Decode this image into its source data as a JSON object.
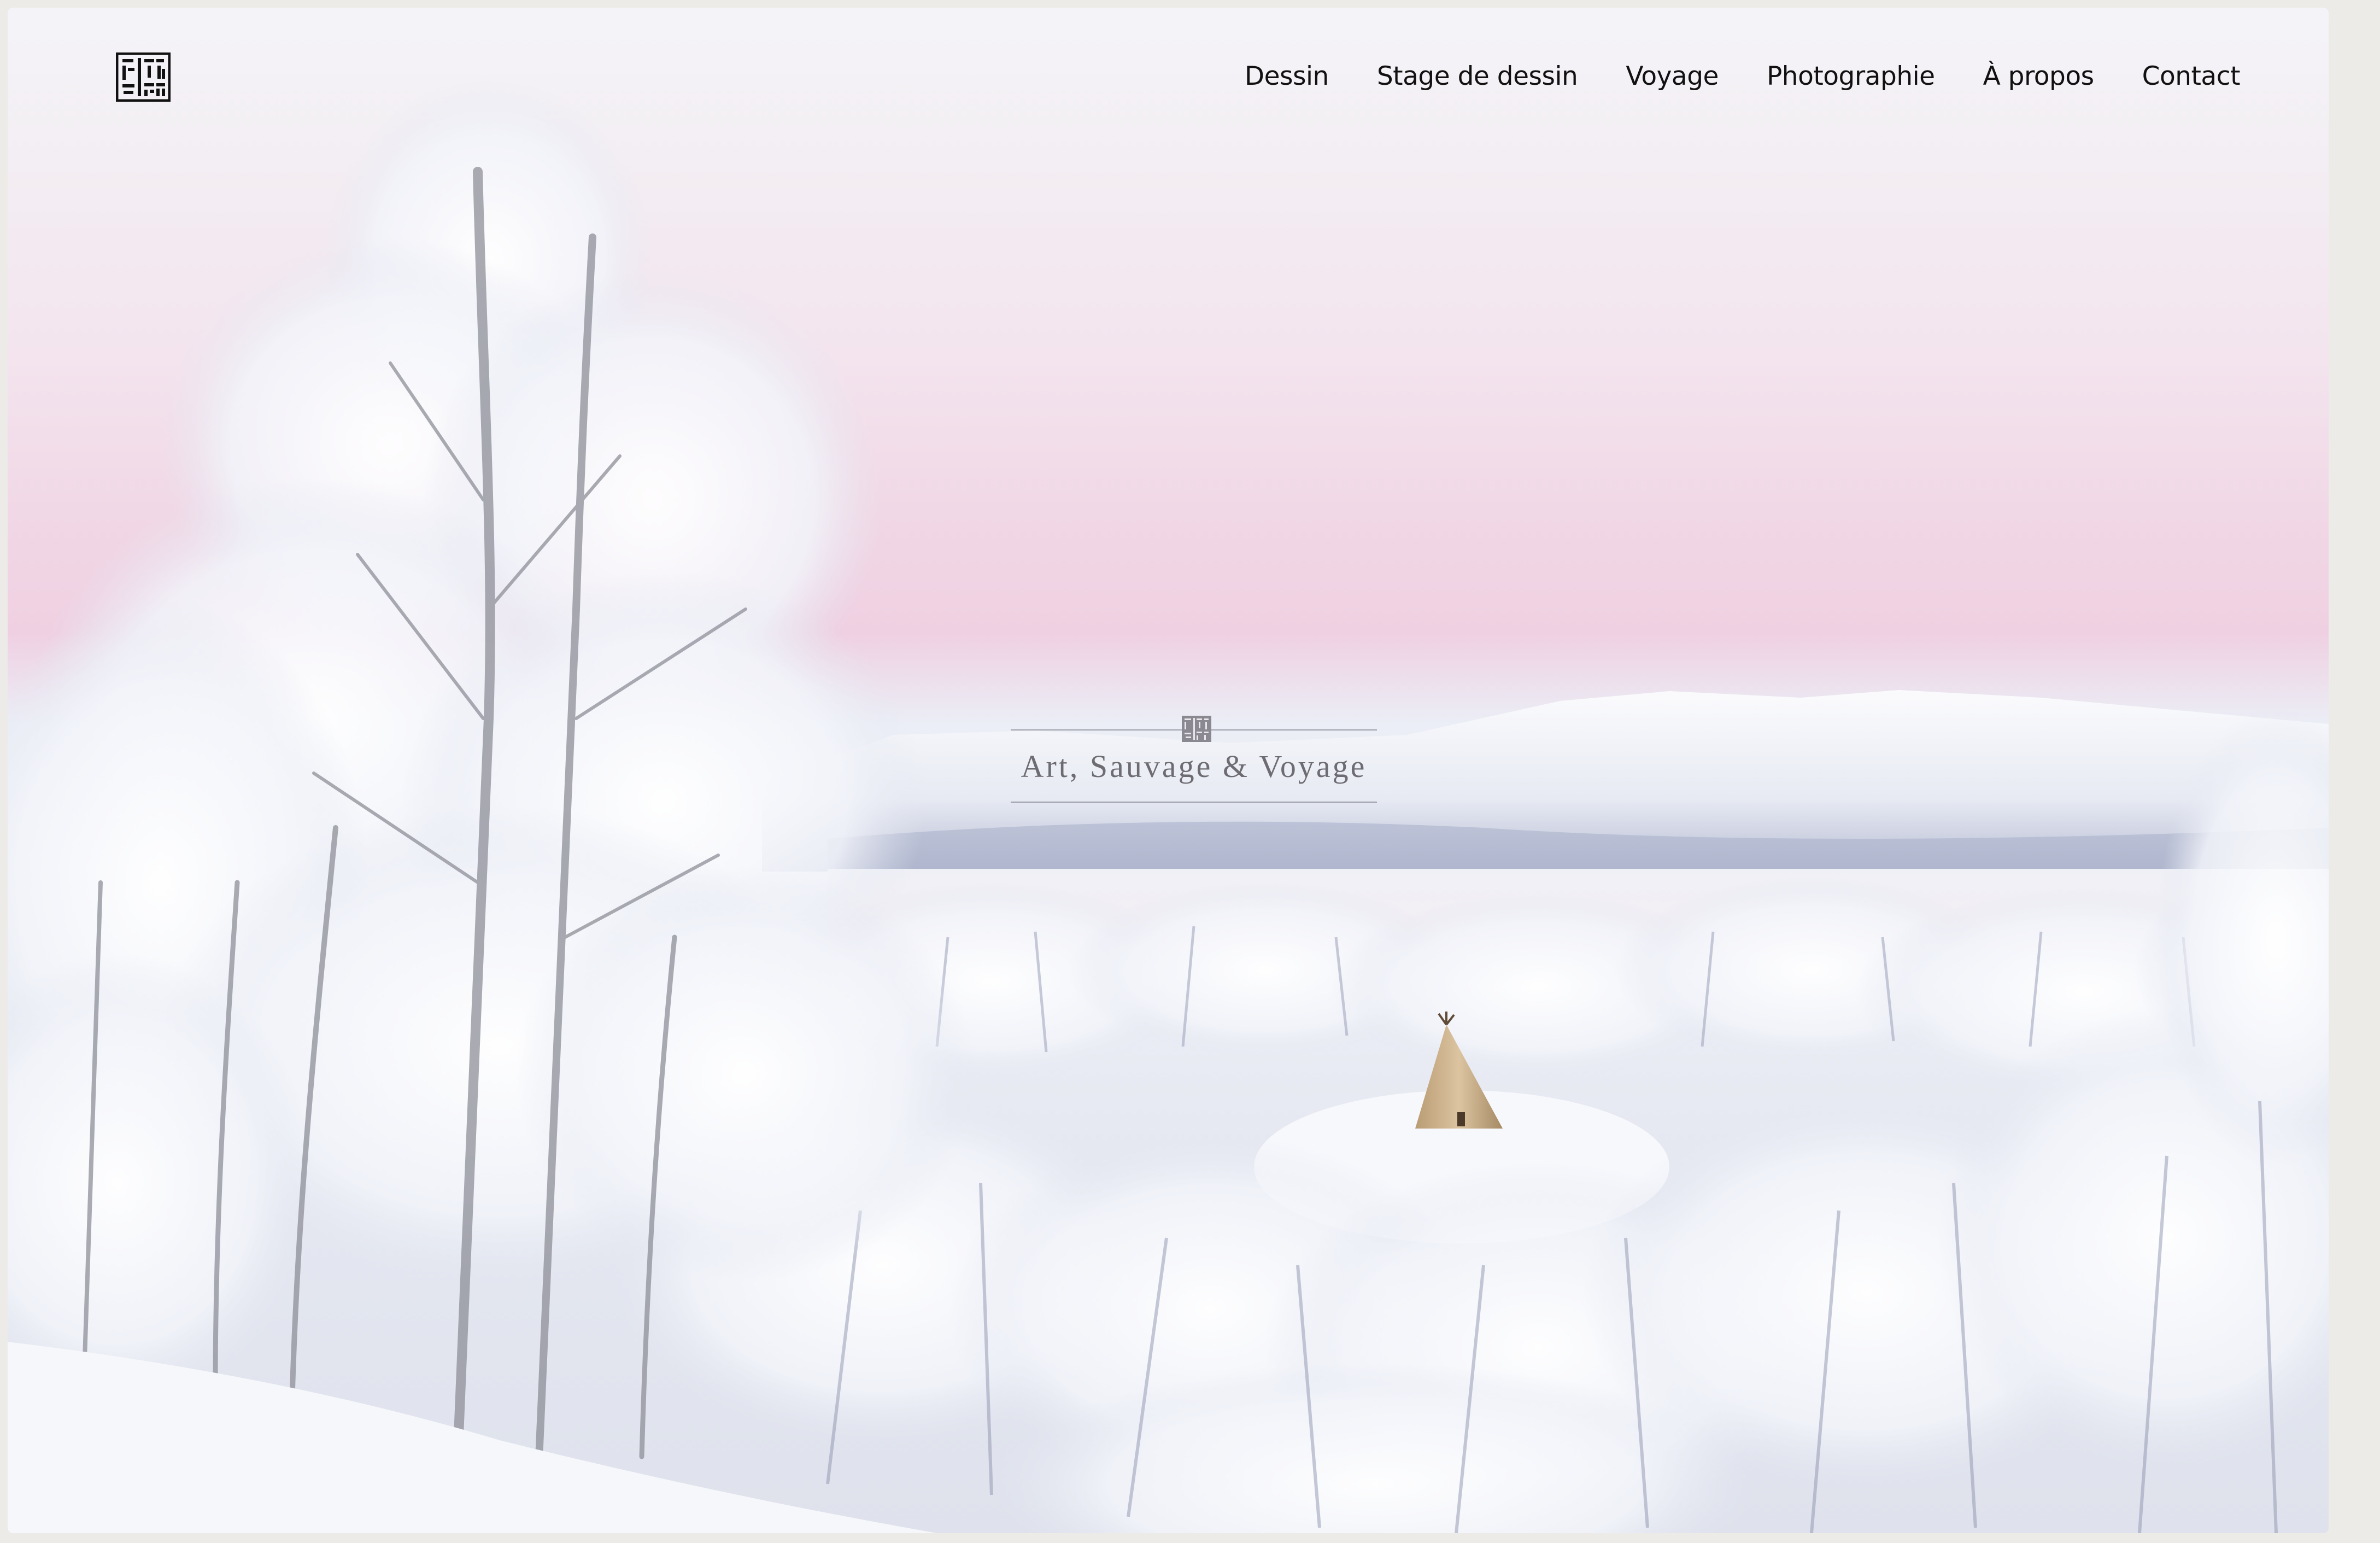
{
  "site": {
    "logo_icon": "seal-logo-icon",
    "nav": [
      "Dessin",
      "Stage de dessin",
      "Voyage",
      "Photographie",
      "À propos",
      "Contact"
    ],
    "tagline": "Art, Sauvage & Voyage",
    "hero_image": "snowy birch forest with a tipi and mountains at dawn"
  },
  "colors": {
    "nav_text": "#111111",
    "tagline_text": "#6e6c73",
    "sky_pink": "#efd0e2",
    "snow": "#f1f2f8"
  }
}
